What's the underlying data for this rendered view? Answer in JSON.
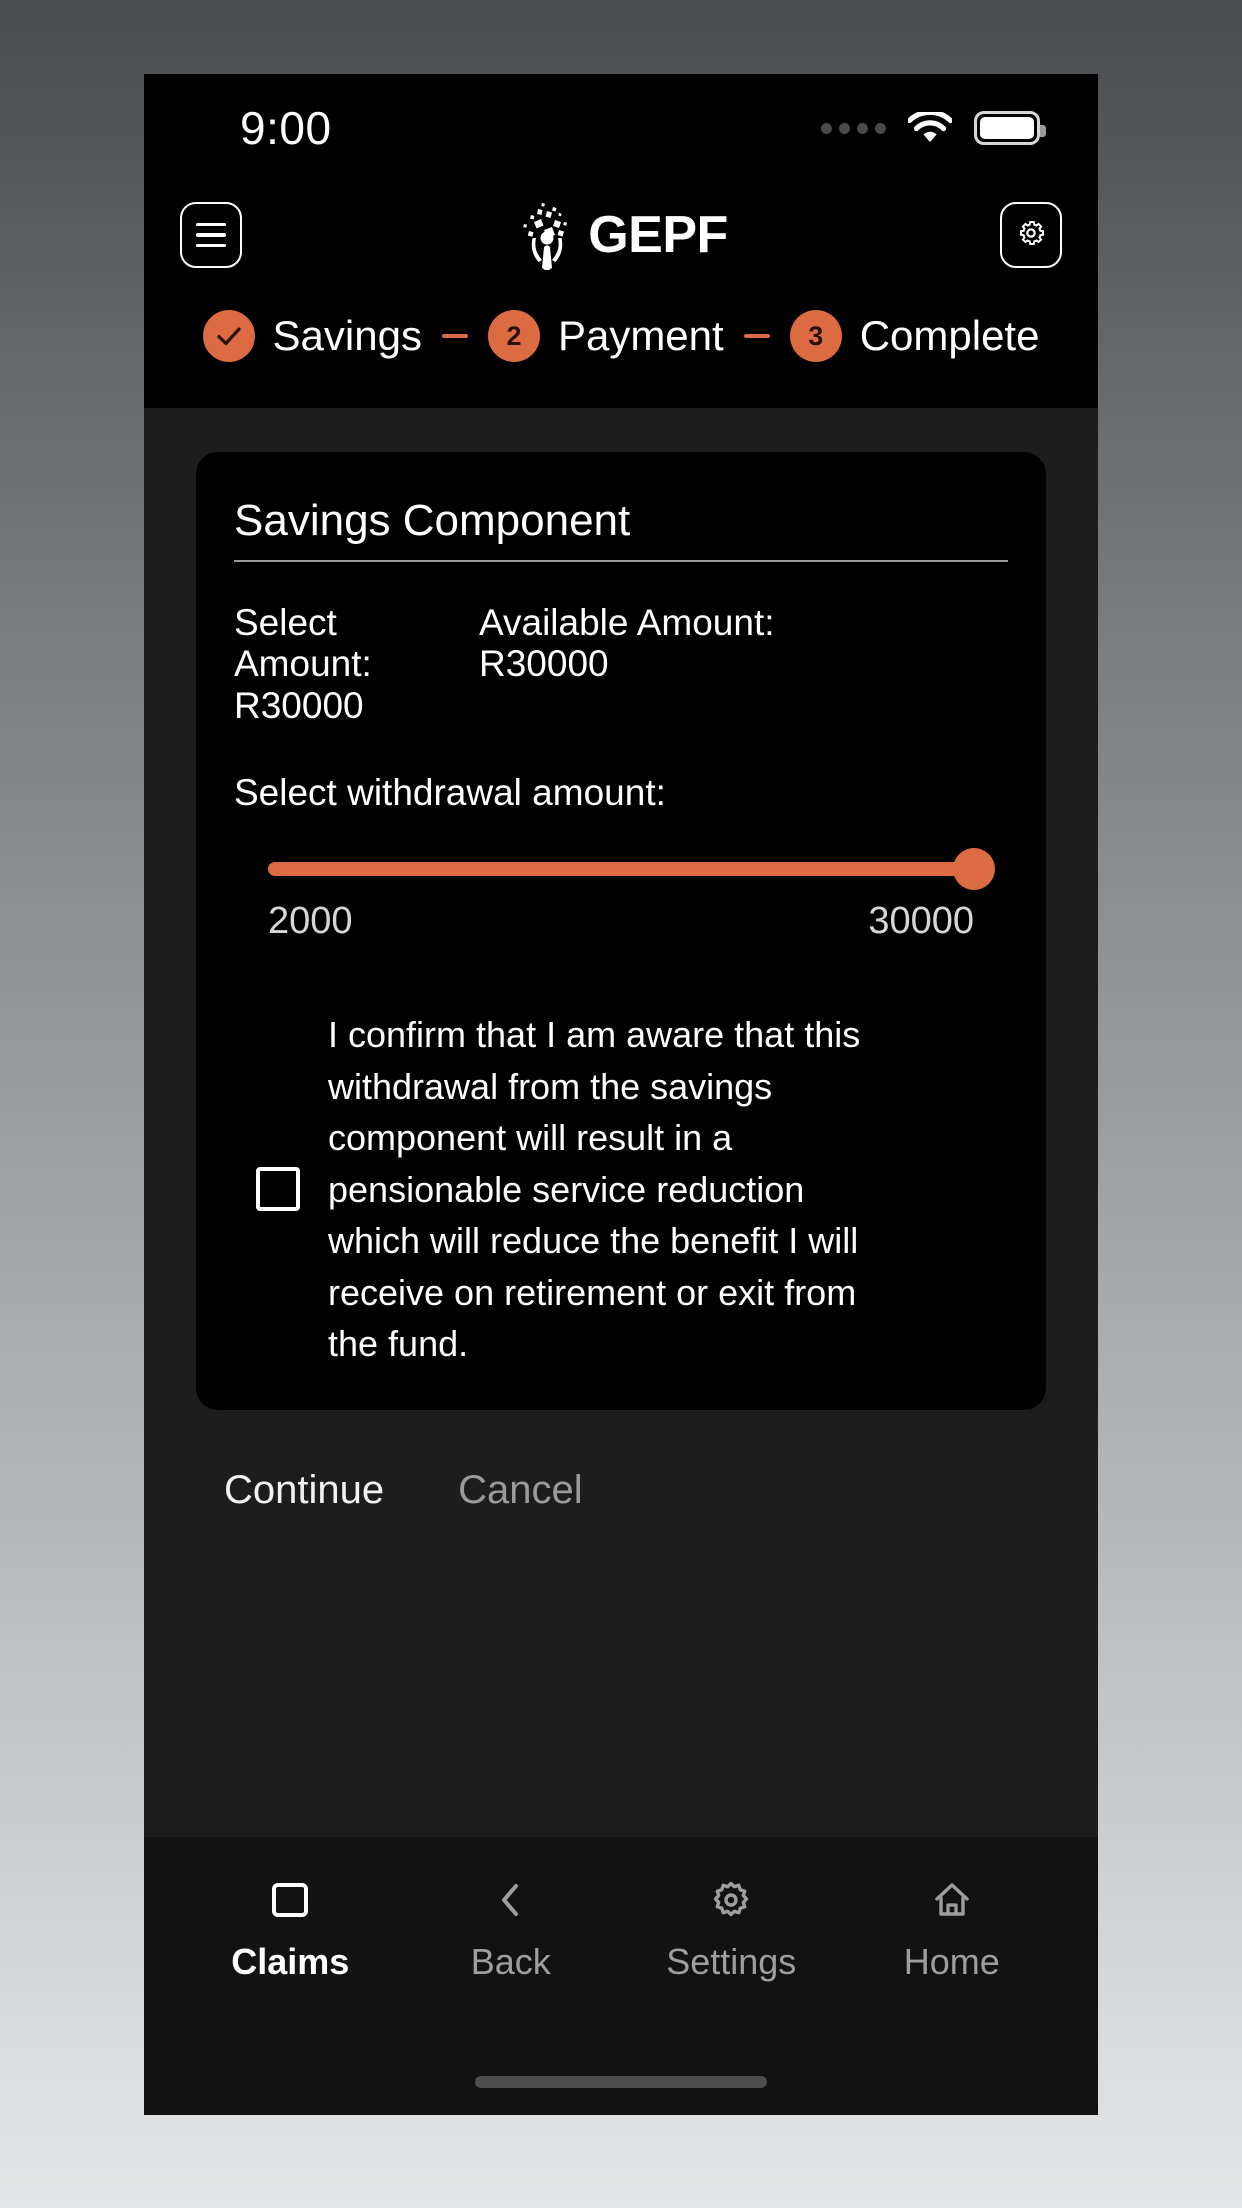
{
  "status_bar": {
    "time": "9:00",
    "signal_icon": "signal-dots-icon",
    "wifi_icon": "wifi-icon",
    "battery_icon": "battery-full-icon"
  },
  "app_bar": {
    "menu_icon": "hamburger-menu-icon",
    "brand_mark_icon": "gepf-logo-icon",
    "brand_text": "GEPF",
    "settings_icon": "gear-icon"
  },
  "stepper": {
    "steps": [
      {
        "marker": "✓",
        "label": "Savings",
        "state": "complete"
      },
      {
        "marker": "2",
        "label": "Payment",
        "state": "current"
      },
      {
        "marker": "3",
        "label": "Complete",
        "state": "upcoming"
      }
    ],
    "separator": "—"
  },
  "card": {
    "title": "Savings Component",
    "select_amount_label": "Select Amount:",
    "select_amount_value": "R30000",
    "available_amount_label": "Available Amount:",
    "available_amount_value": "R30000",
    "slider_label": "Select withdrawal amount:",
    "slider": {
      "min_label": "2000",
      "max_label": "30000",
      "min": 2000,
      "max": 30000,
      "value": 30000,
      "percent": 100
    },
    "confirm": {
      "checked": false,
      "text": "I confirm that I am aware that this withdrawal from the savings component will result in a pensionable service reduction which will reduce the benefit I will receive on retirement or exit from the fund."
    }
  },
  "actions": {
    "continue_label": "Continue",
    "cancel_label": "Cancel"
  },
  "bottom_nav": {
    "items": [
      {
        "label": "Claims",
        "icon": "square-document-icon",
        "active": true
      },
      {
        "label": "Back",
        "icon": "chevron-left-icon",
        "active": false
      },
      {
        "label": "Settings",
        "icon": "gear-icon",
        "active": false
      },
      {
        "label": "Home",
        "icon": "house-icon",
        "active": false
      }
    ]
  },
  "colors": {
    "accent": "#dd6b42",
    "card_bg": "#000000",
    "body_bg": "#1d1d1d",
    "nav_bg": "#121212",
    "text_primary": "#ffffff",
    "text_muted": "#9a9a9a"
  }
}
